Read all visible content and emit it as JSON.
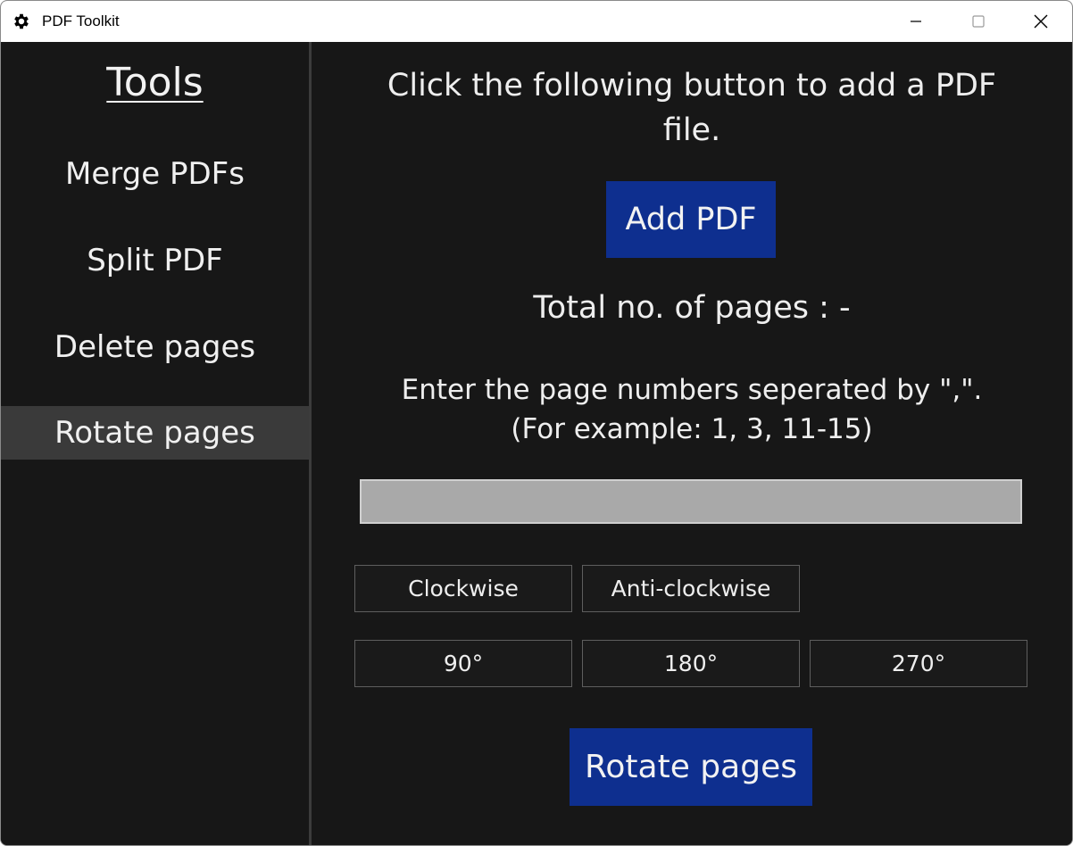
{
  "window": {
    "title": "PDF Toolkit",
    "app_icon": "gear-icon",
    "controls": [
      "minimize-icon",
      "maximize-icon",
      "close-icon"
    ]
  },
  "sidebar": {
    "title": "Tools",
    "items": [
      {
        "label": "Merge PDFs",
        "active": false
      },
      {
        "label": "Split PDF",
        "active": false
      },
      {
        "label": "Delete pages",
        "active": false
      },
      {
        "label": "Rotate pages",
        "active": true
      }
    ]
  },
  "main": {
    "instruction": "Click the following button to add a PDF file.",
    "add_button": "Add PDF",
    "total_pages": "Total no. of pages : -",
    "page_hint_line1": "Enter the page numbers seperated by \",\".",
    "page_hint_line2": "(For example: 1, 3, 11-15)",
    "page_input_value": "",
    "direction_options": [
      "Clockwise",
      "Anti-clockwise"
    ],
    "angle_options": [
      "90°",
      "180°",
      "270°"
    ],
    "rotate_button": "Rotate pages"
  },
  "colors": {
    "background": "#171717",
    "sidebar_active": "#3a3a3a",
    "primary_button": "#0e2f8f",
    "input_background": "#a9a9a9",
    "text": "#eeeeee"
  }
}
